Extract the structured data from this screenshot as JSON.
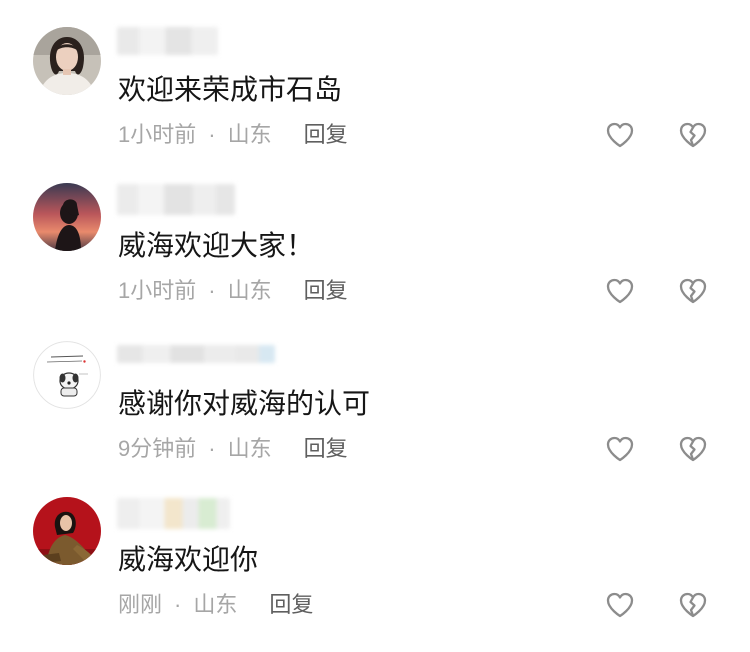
{
  "page": {
    "background": "#ffffff"
  },
  "colors": {
    "text": "#161616",
    "meta": "#a6a6a6",
    "reply": "#5f5f5f",
    "icon": "#8c8c8c"
  },
  "icons": {
    "like": "heart-outline-icon",
    "dislike": "broken-heart-icon"
  },
  "comments": [
    {
      "text": "欢迎来荣成市石岛",
      "time": "1小时前",
      "separator": "·",
      "location": "山东",
      "reply_label": "回复"
    },
    {
      "text": "威海欢迎大家！",
      "time": "1小时前",
      "separator": "·",
      "location": "山东",
      "reply_label": "回复"
    },
    {
      "text": "感谢你对威海的认可",
      "time": "9分钟前",
      "separator": "·",
      "location": "山东",
      "reply_label": "回复"
    },
    {
      "text": "威海欢迎你",
      "time": "刚刚",
      "separator": "·",
      "location": "山东",
      "reply_label": "回复"
    }
  ]
}
